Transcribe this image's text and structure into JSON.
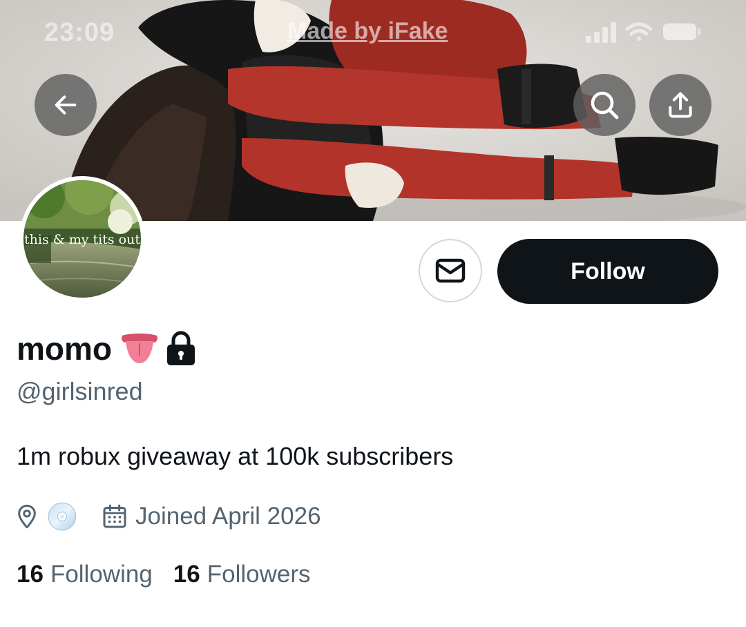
{
  "status_bar": {
    "time": "23:09",
    "watermark": "Made by iFake"
  },
  "header": {
    "back_icon": "arrow-left-icon",
    "search_icon": "search-icon",
    "share_icon": "share-icon"
  },
  "avatar": {
    "overlay_text": "this & my tits out"
  },
  "actions": {
    "message_icon": "envelope-icon",
    "follow_label": "Follow"
  },
  "profile": {
    "display_name": "momo",
    "handle": "@girlsinred",
    "bio": "1m robux giveaway at 100k subscribers",
    "location_icon": "location-pin-icon",
    "location_emoji": "cd-icon",
    "calendar_icon": "calendar-icon",
    "joined": "Joined April 2026"
  },
  "stats": {
    "following_count": "16",
    "following_label": "Following",
    "followers_count": "16",
    "followers_label": "Followers"
  },
  "colors": {
    "primary_text": "#0f1419",
    "secondary_text": "#536471",
    "border": "#cfd9de",
    "button_dark": "#0f1419"
  }
}
